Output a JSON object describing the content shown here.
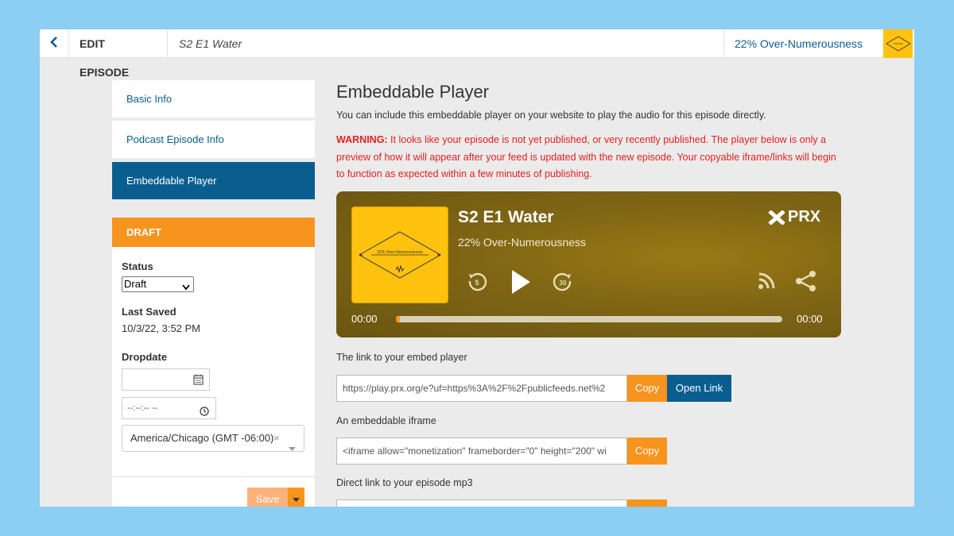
{
  "header": {
    "edit_label": "EDIT EPISODE",
    "episode_title": "S2 E1 Water",
    "podcast_name": "22% Over-Numerousness"
  },
  "sidebar": {
    "items": [
      {
        "label": "Basic Info"
      },
      {
        "label": "Podcast Episode Info"
      },
      {
        "label": "Embeddable Player"
      }
    ],
    "active_index": 2
  },
  "status_panel": {
    "heading": "DRAFT",
    "status_label": "Status",
    "status_value": "Draft",
    "last_saved_label": "Last Saved",
    "last_saved_value": "10/3/22, 3:52 PM",
    "dropdate_label": "Dropdate",
    "time_placeholder": "--:--:-- --",
    "timezone_value": "America/Chicago (GMT -06:00)",
    "save_label": "Save"
  },
  "main": {
    "title": "Embeddable Player",
    "description": "You can include this embeddable player on your website to play the audio for this episode directly.",
    "warning_prefix": "WARNING:",
    "warning_text": " It looks like your episode is not yet published, or very recently published. The player below is only a preview of how it will appear after your feed is updated with the new episode. Your copyable iframe/links will begin to function as expected within a few minutes of publishing."
  },
  "player": {
    "title": "S2 E1 Water",
    "subtitle": "22% Over-Numerousness",
    "logo_text": "PRX",
    "art_text": "22% Over-Numerousness",
    "rewind_seconds": "5",
    "forward_seconds": "30",
    "time_current": "00:00",
    "time_total": "00:00",
    "progress": 0.0
  },
  "embed": {
    "link_label": "The link to your embed player",
    "link_value": "https://play.prx.org/e?uf=https%3A%2F%2Fpublicfeeds.net%2",
    "iframe_label": "An embeddable iframe",
    "iframe_value": "<iframe allow=\"monetization\" frameborder=\"0\" height=\"200\" wi",
    "mp3_label": "Direct link to your episode mp3",
    "copy_label": "Copy",
    "open_label": "Open Link"
  },
  "colors": {
    "accent_blue": "#0a5e8f",
    "accent_orange": "#f7941d",
    "warning_red": "#e5201f",
    "brand_yellow": "#ffc20e"
  }
}
